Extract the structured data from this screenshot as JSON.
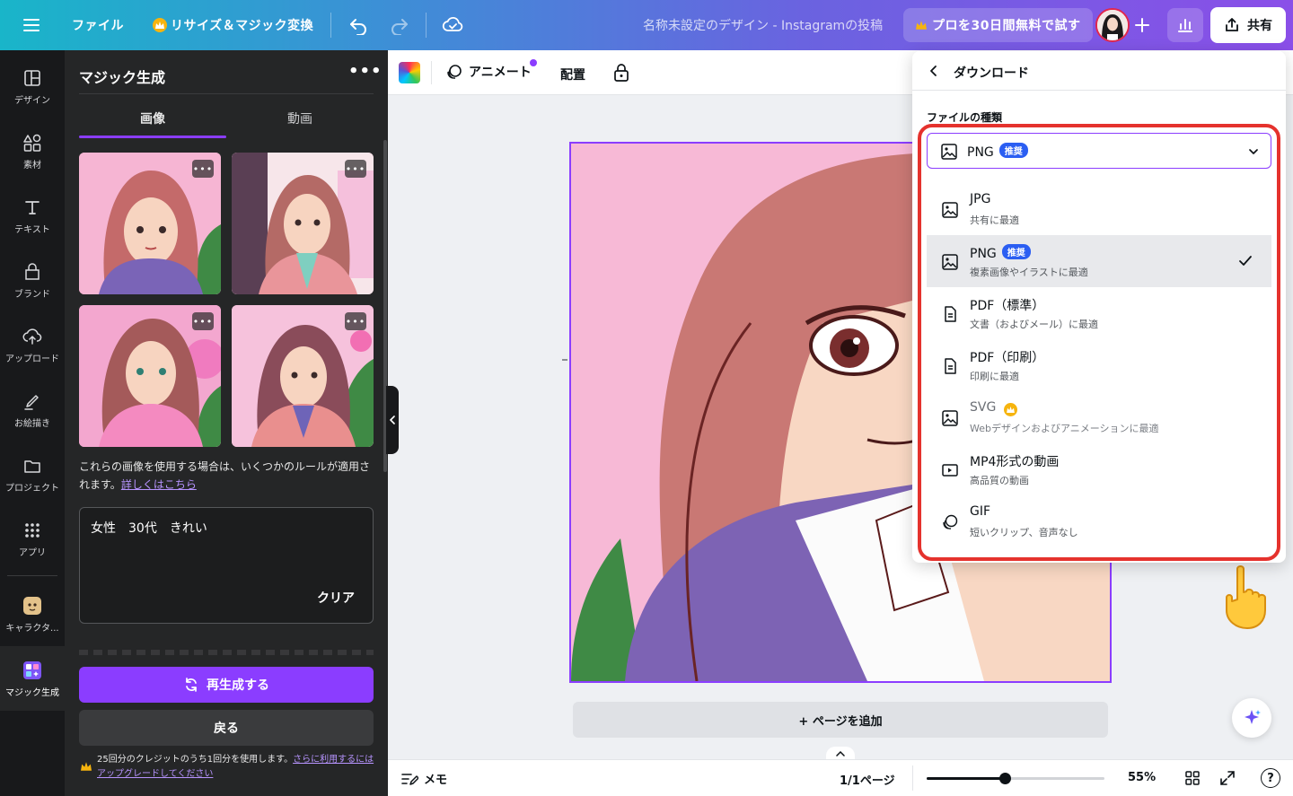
{
  "topbar": {
    "file_label": "ファイル",
    "resize_label": "リサイズ＆マジック変換",
    "doc_title": "名称未設定のデザイン - Instagramの投稿",
    "pro_label": "プロを30日間無料で試す",
    "share_label": "共有"
  },
  "rail": {
    "items": [
      {
        "label": "デザイン",
        "icon": "layout-icon"
      },
      {
        "label": "素材",
        "icon": "shapes-icon"
      },
      {
        "label": "テキスト",
        "icon": "text-icon"
      },
      {
        "label": "ブランド",
        "icon": "brand-icon"
      },
      {
        "label": "アップロード",
        "icon": "upload-cloud-icon"
      },
      {
        "label": "お絵描き",
        "icon": "draw-icon"
      },
      {
        "label": "プロジェクト",
        "icon": "folder-icon"
      },
      {
        "label": "アプリ",
        "icon": "apps-grid-icon"
      },
      {
        "label": "キャラクタ...",
        "icon": "character-icon"
      },
      {
        "label": "マジック生成",
        "icon": "magic-generate-icon"
      }
    ]
  },
  "panel": {
    "title": "マジック生成",
    "tab_image": "画像",
    "tab_video": "動画",
    "notice": "これらの画像を使用する場合は、いくつかのルールが適用されます。",
    "notice_link": "詳しくはこちら",
    "prompt_text": "女性　30代　きれい",
    "clear_label": "クリア",
    "regenerate_label": "再生成する",
    "back_label": "戻る",
    "credit_text": "25回分のクレジットのうち1回分を使用します。",
    "credit_link": "さらに利用するにはアップグレードしてください"
  },
  "canvas_toolbar": {
    "animate_label": "アニメート",
    "arrange_label": "配置"
  },
  "canvas": {
    "add_page_label": "+ ページを追加"
  },
  "bottombar": {
    "notes_label": "メモ",
    "page_label": "1/1ページ",
    "zoom_label": "55%",
    "zoom_fraction": 0.44
  },
  "download": {
    "title": "ダウンロード",
    "file_type_label": "ファイルの種類",
    "selected": "PNG",
    "recommended_badge": "推奨",
    "options": [
      {
        "label": "JPG",
        "sub": "共有に最適",
        "icon": "image-icon"
      },
      {
        "label": "PNG",
        "sub": "複素画像やイラストに最適",
        "icon": "image-icon",
        "badge": "推奨",
        "selected": true
      },
      {
        "label": "PDF（標準）",
        "sub": "文書（およびメール）に最適",
        "icon": "document-icon"
      },
      {
        "label": "PDF（印刷）",
        "sub": "印刷に最適",
        "icon": "document-icon"
      },
      {
        "label": "SVG",
        "sub": "Webデザインおよびアニメーションに最適",
        "icon": "image-icon",
        "pro": true
      },
      {
        "label": "MP4形式の動画",
        "sub": "高品質の動画",
        "icon": "video-icon"
      },
      {
        "label": "GIF",
        "sub": "短いクリップ、音声なし",
        "icon": "gif-icon"
      }
    ]
  },
  "colors": {
    "accent": "#8b3dff",
    "highlight_border": "#e5322d",
    "badge_blue": "#2b5ef2",
    "panel_bg": "#252627",
    "rail_bg": "#18191b"
  }
}
